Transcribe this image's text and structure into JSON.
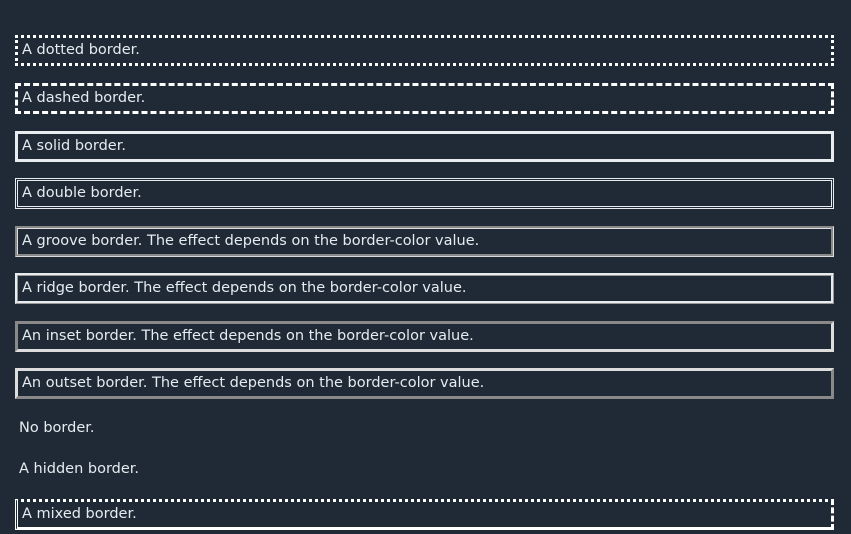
{
  "items": [
    {
      "label": "A dotted border."
    },
    {
      "label": "A dashed border."
    },
    {
      "label": "A solid border."
    },
    {
      "label": "A double border."
    },
    {
      "label": "A groove border. The effect depends on the border-color value."
    },
    {
      "label": "A ridge border. The effect depends on the border-color value."
    },
    {
      "label": "An inset border. The effect depends on the border-color value."
    },
    {
      "label": "An outset border. The effect depends on the border-color value."
    },
    {
      "label": "No border."
    },
    {
      "label": "A hidden border."
    },
    {
      "label": "A mixed border."
    }
  ],
  "colors": {
    "background": "#1f2a36",
    "text": "#e6ebf0",
    "border": "#ffffff"
  }
}
